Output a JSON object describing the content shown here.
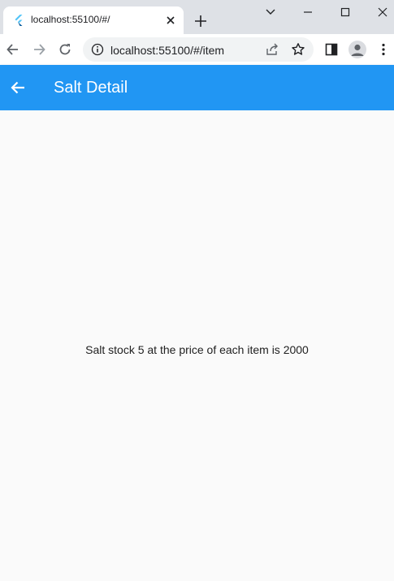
{
  "browser": {
    "tab": {
      "title": "localhost:55100/#/"
    },
    "address_bar": {
      "url": "localhost:55100/#/item"
    }
  },
  "app_bar": {
    "title": "Salt Detail"
  },
  "item_detail": {
    "message": "Salt stock 5 at the price of each item is 2000"
  },
  "colors": {
    "app_bar_background": "#2196f3",
    "app_bar_foreground": "#ffffff",
    "page_background": "#fafafa",
    "tab_strip": "#dee1e6",
    "flutter_logo": "#54c5f8"
  },
  "icons": {
    "favicon": "flutter-logo-icon",
    "tab_close": "close-icon",
    "new_tab": "plus-icon",
    "tab_search": "chevron-down-icon",
    "minimize": "minimize-icon",
    "maximize": "maximize-icon",
    "window_close": "close-icon",
    "back": "arrow-left-icon",
    "forward": "arrow-right-icon",
    "reload": "reload-icon",
    "site_info": "info-icon",
    "share": "share-icon",
    "bookmark": "star-icon",
    "side_panel": "side-panel-icon",
    "profile": "profile-icon",
    "menu": "more-vert-icon",
    "app_back": "arrow-left-icon"
  }
}
